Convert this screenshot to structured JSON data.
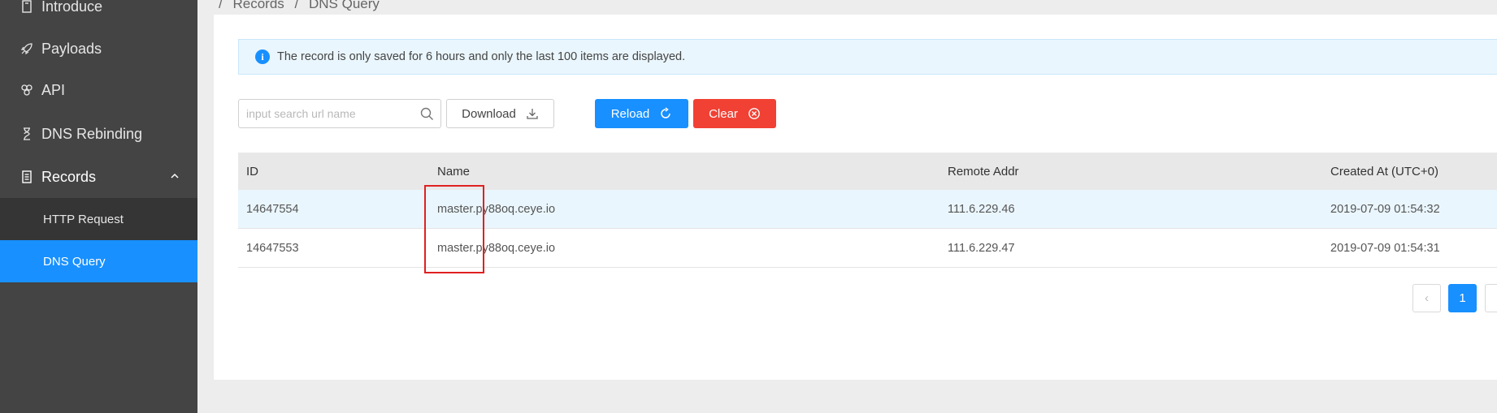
{
  "sidebar": {
    "items": [
      {
        "label": "Introduce",
        "icon": "document-icon"
      },
      {
        "label": "Payloads",
        "icon": "rocket-icon"
      },
      {
        "label": "API",
        "icon": "api-icon"
      },
      {
        "label": "DNS Rebinding",
        "icon": "hourglass-icon"
      },
      {
        "label": "Records",
        "icon": "list-icon"
      }
    ],
    "sub_items": [
      {
        "label": "HTTP Request"
      },
      {
        "label": "DNS Query"
      }
    ]
  },
  "breadcrumb": [
    "Records",
    "/",
    "DNS Query"
  ],
  "alert": {
    "text": "The record is only saved for 6 hours and only the last 100 items are displayed."
  },
  "search": {
    "placeholder": "input search url name",
    "value": ""
  },
  "buttons": {
    "download": "Download",
    "reload": "Reload",
    "clear": "Clear"
  },
  "table": {
    "columns": [
      "ID",
      "Name",
      "Remote Addr",
      "Created At (UTC+0)"
    ],
    "rows": [
      {
        "id": "14647554",
        "name": "master.py88oq.ceye.io",
        "addr": "111.6.229.46",
        "created": "2019-07-09 01:54:32"
      },
      {
        "id": "14647553",
        "name": "master.py88oq.ceye.io",
        "addr": "111.6.229.47",
        "created": "2019-07-09 01:54:31"
      }
    ]
  },
  "pagination": {
    "prev": "‹",
    "current": "1"
  },
  "colors": {
    "accent": "#1890ff",
    "danger": "#f04134",
    "sidebar": "#444444"
  }
}
